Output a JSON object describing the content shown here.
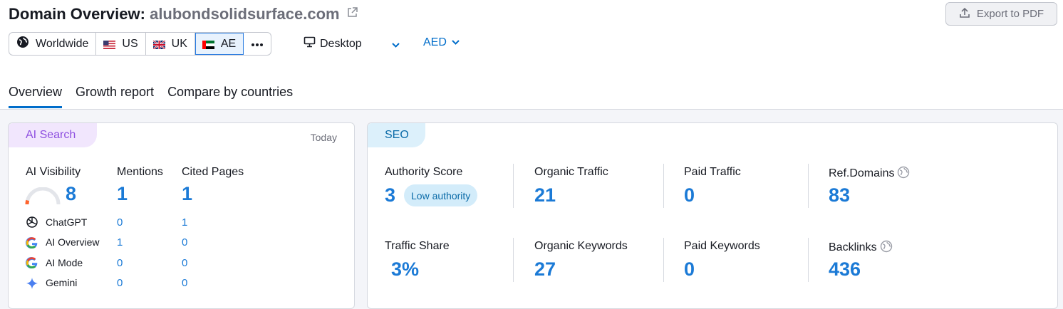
{
  "header": {
    "title_prefix": "Domain Overview:",
    "domain": "alubondsolidsurface.com",
    "external_link_icon": "external-link-icon",
    "export_label": "Export to PDF",
    "export_icon": "upload-icon"
  },
  "filters": {
    "databases": [
      {
        "label": "Worldwide",
        "icon": "globe-icon"
      },
      {
        "label": "US",
        "icon": "us-flag-icon"
      },
      {
        "label": "UK",
        "icon": "uk-flag-icon"
      },
      {
        "label": "AE",
        "icon": "ae-flag-icon",
        "selected": true
      }
    ],
    "more_icon": "more-dots-icon",
    "device_label": "Desktop",
    "device_icon": "monitor-icon",
    "currency": "AED"
  },
  "tabs": [
    {
      "label": "Overview",
      "active": true
    },
    {
      "label": "Growth report"
    },
    {
      "label": "Compare by countries"
    }
  ],
  "ai_search": {
    "tag": "AI Search",
    "date": "Today",
    "visibility_label": "AI Visibility",
    "visibility_value": "8",
    "visibility_gauge_fraction": 0.08,
    "mentions_label": "Mentions",
    "mentions_value": "1",
    "cited_label": "Cited Pages",
    "cited_value": "1",
    "platforms": [
      {
        "name": "ChatGPT",
        "icon": "chatgpt-icon",
        "mentions": "0",
        "cited": "1"
      },
      {
        "name": "AI Overview",
        "icon": "google-icon",
        "mentions": "1",
        "cited": "0"
      },
      {
        "name": "AI Mode",
        "icon": "google-icon",
        "mentions": "0",
        "cited": "0"
      },
      {
        "name": "Gemini",
        "icon": "gemini-icon",
        "mentions": "0",
        "cited": "0"
      }
    ]
  },
  "seo": {
    "tag": "SEO",
    "metrics": [
      {
        "label": "Authority Score",
        "value": "3",
        "badge": "Low authority"
      },
      {
        "label": "Organic Traffic",
        "value": "21"
      },
      {
        "label": "Paid Traffic",
        "value": "0"
      },
      {
        "label": "Ref.Domains",
        "value": "83",
        "icon": "info-globe-icon"
      },
      {
        "label": "Traffic Share",
        "value": "3%"
      },
      {
        "label": "Organic Keywords",
        "value": "27"
      },
      {
        "label": "Paid Keywords",
        "value": "0"
      },
      {
        "label": "Backlinks",
        "value": "436",
        "icon": "info-globe-icon"
      }
    ]
  },
  "colors": {
    "accent": "#006dca",
    "metric_value": "#1b7ad6",
    "ai_tag_bg": "#f1e6fd",
    "ai_tag_text": "#8e4fe0",
    "seo_tag_bg": "#dcf0fb",
    "gauge_active": "#ff642d"
  }
}
